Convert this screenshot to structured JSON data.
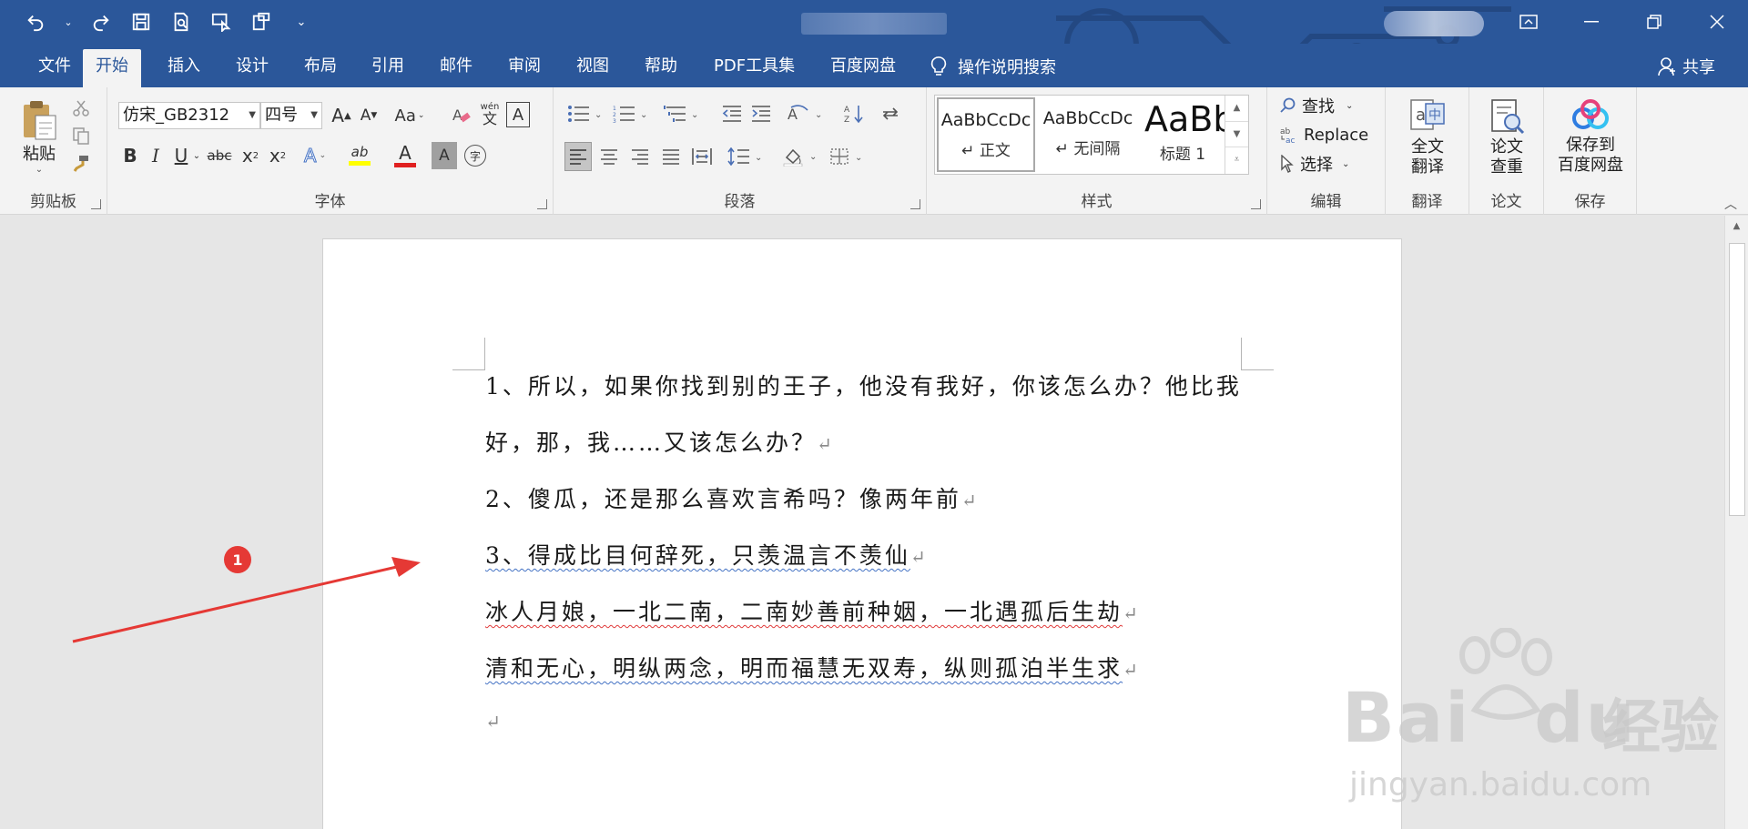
{
  "colors": {
    "brand": "#2b579a",
    "ribbon": "#f3f3f3",
    "badge": "#e53935",
    "spell_red": "#e03b3b",
    "grammar_blue": "#4472c4"
  },
  "qat": {
    "undo_icon": "undo-icon",
    "redo_icon": "redo-icon",
    "save_icon": "save-icon",
    "preview_icon": "print-preview-icon",
    "touch_icon": "touch-mode-icon",
    "more_icon": "customize-icon",
    "more_glyph": "⌄"
  },
  "tabs": [
    {
      "label": "文件"
    },
    {
      "label": "开始"
    },
    {
      "label": "插入"
    },
    {
      "label": "设计"
    },
    {
      "label": "布局"
    },
    {
      "label": "引用"
    },
    {
      "label": "邮件"
    },
    {
      "label": "审阅"
    },
    {
      "label": "视图"
    },
    {
      "label": "帮助"
    },
    {
      "label": "PDF工具集"
    },
    {
      "label": "百度网盘"
    }
  ],
  "tell_me": "操作说明搜索",
  "share": "共享",
  "clipboard": {
    "paste": "粘贴",
    "label": "剪贴板"
  },
  "font": {
    "name": "仿宋_GB2312",
    "size": "四号",
    "label": "字体",
    "grow": "A",
    "shrink": "A",
    "case": "Aa",
    "phonetic": "wén",
    "phonetic_char": "文",
    "border_char": "A",
    "bold": "B",
    "italic": "I",
    "underline": "U",
    "strike": "abc",
    "sub": "x",
    "sup": "x",
    "effects": "A",
    "highlight": "ab",
    "color": "A",
    "shading": "A",
    "enclose": "字"
  },
  "paragraph": {
    "label": "段落"
  },
  "styles": {
    "label": "样式",
    "items": [
      {
        "preview": "AaBbCcDc",
        "name": "↵ 正文"
      },
      {
        "preview": "AaBbCcDc",
        "name": "↵ 无间隔"
      },
      {
        "preview": "AaBb",
        "name": "标题 1"
      }
    ]
  },
  "editing": {
    "find": "查找",
    "replace": "Replace",
    "select": "选择",
    "label": "编辑"
  },
  "translate": {
    "btn_l1": "全文",
    "btn_l2": "翻译",
    "label": "翻译"
  },
  "paper": {
    "btn_l1": "论文",
    "btn_l2": "查重",
    "label": "论文"
  },
  "save_group": {
    "btn_l1": "保存到",
    "btn_l2": "百度网盘",
    "label": "保存"
  },
  "document": {
    "lines": [
      "1、所以，如果你找到别的王子，他没有我好，你该怎么办？他比我",
      "好，那，我……又该怎么办？",
      "2、傻瓜，还是那么喜欢言希吗？像两年前",
      "3、得成比目何辞死，只羡温言不羡仙",
      "冰人月娘，一北二南，二南妙善前种姻，一北遇孤后生劫",
      "清和无心，明纵两念，明而福慧无双寿，纵则孤泊半生求"
    ],
    "paragraph_mark": "↵"
  },
  "annotation": {
    "badge": "1"
  },
  "watermark": {
    "brand": "Bai",
    "brand2": "du",
    "cn": "经验",
    "url": "jingyan.baidu.com"
  }
}
